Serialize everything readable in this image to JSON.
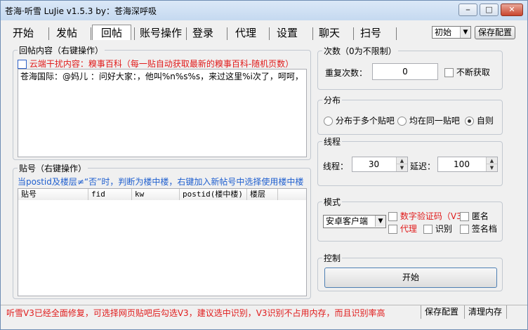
{
  "window": {
    "title": "苍海·听雪  LuJie  v1.5.3  by：苍海深呼吸",
    "minimize": "⎯",
    "maximize": "□",
    "close": "✕"
  },
  "tabs": [
    {
      "label": "开始"
    },
    {
      "label": "发帖"
    },
    {
      "label": "回帖",
      "active": true
    },
    {
      "label": "账号操作"
    },
    {
      "label": "登录"
    },
    {
      "label": "代理"
    },
    {
      "label": "设置"
    },
    {
      "label": "聊天"
    },
    {
      "label": "扫号"
    }
  ],
  "config": {
    "profile_value": "初始",
    "save_label": "保存配置"
  },
  "reply": {
    "legend": "回帖内容（右键操作）",
    "interference_label": "云端干扰内容：糗事百科（每一贴自动获取最新的糗事百科-随机页数）",
    "content_text": "苍海国际：@妈儿    ：问好大家：，他叫%n%s%s，来过这里%i次了，呵呵，"
  },
  "posts": {
    "legend": "贴号（右键操作）",
    "hint": "当postid及楼层≠“否”时，判断为楼中楼，右键加入新帖号中选择使用楼中楼",
    "columns": [
      "贴号",
      "fid",
      "kw",
      "postid(楼中楼)",
      "楼层"
    ]
  },
  "count": {
    "legend": "次数（0为不限制）",
    "repeat_label": "重复次数：",
    "repeat_value": "0",
    "nonstop_label": "不断获取"
  },
  "distribution": {
    "legend": "分布",
    "options": [
      "分布于多个贴吧",
      "均在同一贴吧",
      "自则"
    ],
    "selected": "自则"
  },
  "threads": {
    "legend": "线程",
    "threads_label": "线程：",
    "threads_value": "30",
    "delay_label": "延迟：",
    "delay_value": "100"
  },
  "mode": {
    "legend": "模式",
    "mode_value": "安卓客户端",
    "captcha_label": "数字验证码（V3）",
    "anonymous_label": "匿名",
    "proxy_label": "代理",
    "recognize_label": "识别",
    "signature_label": "签名档"
  },
  "control": {
    "legend": "控制",
    "start_label": "开始"
  },
  "status": {
    "message": "听雪V3已经全面修复，可选择网页贴吧后勾选V3，建议选中识别，V3识别不占用内存，而且识别率高",
    "save_label": "保存配置",
    "clear_label": "清理内存"
  },
  "colors": {
    "accent_red": "#e01b1b",
    "accent_blue": "#1f5fcf"
  }
}
